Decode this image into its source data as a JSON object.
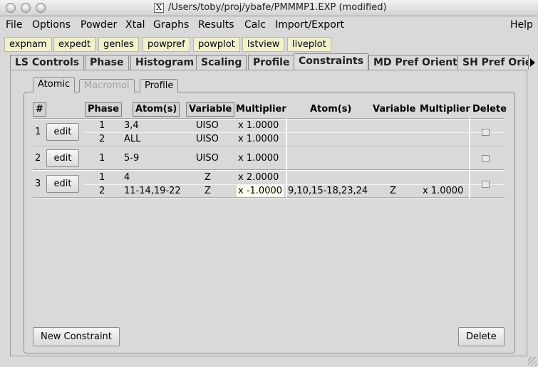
{
  "window": {
    "title": "/Users/toby/proj/ybafe/PMMMP1.EXP (modified)",
    "x11_glyph": "X"
  },
  "menu": [
    "File",
    "Options",
    "Powder",
    "Xtal",
    "Graphs",
    "Results",
    "Calc",
    "Import/Export",
    "Help"
  ],
  "toolbar": [
    "expnam",
    "expedt",
    "genles",
    "powpref",
    "powplot",
    "lstview",
    "liveplot"
  ],
  "tabs": [
    "LS Controls",
    "Phase",
    "Histogram",
    "Scaling",
    "Profile",
    "Constraints",
    "MD Pref Orient",
    "SH Pref Orien"
  ],
  "active_tab": "Constraints",
  "subtabs": [
    {
      "label": "Atomic",
      "state": "active"
    },
    {
      "label": "Macromol",
      "state": "disabled"
    },
    {
      "label": "Profile",
      "state": "normal"
    }
  ],
  "table": {
    "headers": {
      "num": "#",
      "phase": "Phase",
      "atoms": "Atom(s)",
      "variable": "Variable",
      "multiplier": "Multiplier",
      "atoms2": "Atom(s)",
      "variable2": "Variable",
      "multiplier2": "Multiplier",
      "delete": "Delete"
    },
    "edit_label": "edit",
    "constraints": [
      {
        "num": "1",
        "rows": [
          {
            "phase": "1",
            "atoms": "3,4",
            "variable": "UISO",
            "multiplier": "x 1.0000"
          },
          {
            "phase": "2",
            "atoms": "ALL",
            "variable": "UISO",
            "multiplier": "x 1.0000"
          }
        ]
      },
      {
        "num": "2",
        "rows": [
          {
            "phase": "1",
            "atoms": "5-9",
            "variable": "UISO",
            "multiplier": "x 1.0000"
          }
        ]
      },
      {
        "num": "3",
        "rows": [
          {
            "phase": "1",
            "atoms": "4",
            "variable": "Z",
            "multiplier": "x 2.0000"
          },
          {
            "phase": "2",
            "atoms": "11-14,19-22",
            "variable": "Z",
            "multiplier": "x -1.0000",
            "atoms2": "9,10,15-18,23,24",
            "variable2": "Z",
            "multiplier2": "x 1.0000"
          }
        ]
      }
    ]
  },
  "buttons": {
    "new_constraint": "New Constraint",
    "delete": "Delete"
  }
}
